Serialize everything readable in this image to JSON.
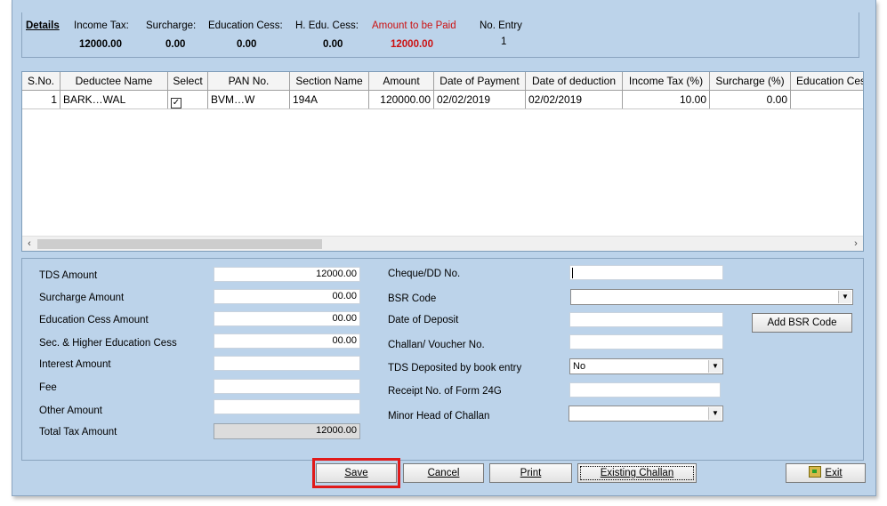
{
  "details": {
    "title": "Details",
    "income_tax_label": "Income Tax:",
    "income_tax_value": "12000.00",
    "surcharge_label": "Surcharge:",
    "surcharge_value": "0.00",
    "edu_cess_label": "Education Cess:",
    "edu_cess_value": "0.00",
    "h_edu_cess_label": "H. Edu. Cess:",
    "h_edu_cess_value": "0.00",
    "amount_paid_label": "Amount to be Paid",
    "amount_paid_value": "12000.00",
    "no_entry_label": "No. Entry",
    "no_entry_value": "1",
    "accent_color": "#cc1111"
  },
  "grid": {
    "columns": [
      "S.No.",
      "Deductee Name",
      "Select",
      "PAN No.",
      "Section Name",
      "Amount",
      "Date of Payment",
      "Date of deduction",
      "Income Tax (%)",
      "Surcharge (%)",
      "Education Ces"
    ],
    "rows": [
      {
        "sno": "1",
        "deductee_name": "BARK…WAL",
        "selected": true,
        "pan": "BVM…W",
        "section": "194A",
        "amount": "120000.00",
        "date_of_payment": "02/02/2019",
        "date_of_deduction": "02/02/2019",
        "income_tax_pct": "10.00",
        "surcharge_pct": "0.00",
        "education_cess": ""
      }
    ]
  },
  "form": {
    "tds_amount_label": "TDS Amount",
    "tds_amount_value": "12000.00",
    "surcharge_amount_label": "Surcharge Amount",
    "surcharge_amount_value": "00.00",
    "edu_cess_amount_label": "Education Cess Amount",
    "edu_cess_amount_value": "00.00",
    "sec_higher_edu_cess_label": "Sec. & Higher Education Cess",
    "sec_higher_edu_cess_value": "00.00",
    "interest_amount_label": "Interest Amount",
    "interest_amount_value": "",
    "fee_label": "Fee",
    "fee_value": "",
    "other_amount_label": "Other Amount",
    "other_amount_value": "",
    "total_tax_amount_label": "Total Tax Amount",
    "total_tax_amount_value": "12000.00",
    "cheque_dd_label": "Cheque/DD No.",
    "cheque_dd_value": "",
    "bsr_code_label": "BSR Code",
    "bsr_code_value": "",
    "date_of_deposit_label": "Date of Deposit",
    "date_of_deposit_value": "",
    "add_bsr_code_label": "Add BSR Code",
    "challan_voucher_label": "Challan/ Voucher No.",
    "challan_voucher_value": "",
    "tds_book_entry_label": "TDS Deposited by book entry",
    "tds_book_entry_value": "No",
    "receipt_24g_label": "Receipt No. of Form 24G",
    "receipt_24g_value": "",
    "minor_head_label": "Minor Head of Challan",
    "minor_head_value": ""
  },
  "buttons": {
    "save": "Save",
    "cancel": "Cancel",
    "print": "Print",
    "existing_challan": "Existing Challan",
    "exit": "Exit"
  }
}
